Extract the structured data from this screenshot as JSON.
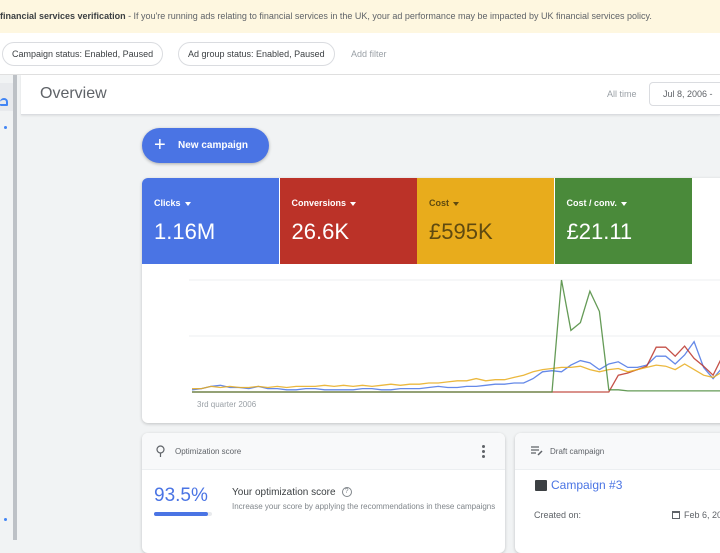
{
  "banner": {
    "title": "financial services verification",
    "text": " - If you're running ads relating to financial services in the UK, your ad performance may be impacted by UK financial services policy."
  },
  "filters": {
    "chips": [
      "Campaign status: Enabled, Paused",
      "Ad group status: Enabled, Paused"
    ],
    "add_filter": "Add filter"
  },
  "header": {
    "title": "Overview",
    "range_label": "All time",
    "date_range": "Jul 8, 2006 -"
  },
  "new_campaign": {
    "label": "New campaign",
    "icon": "plus-icon"
  },
  "metrics": [
    {
      "label": "Clicks",
      "value": "1.16M",
      "color": "#4a74e4",
      "text_color": "#ffffff"
    },
    {
      "label": "Conversions",
      "value": "26.6K",
      "color": "#bb3228",
      "text_color": "#ffffff"
    },
    {
      "label": "Cost",
      "value": "£595K",
      "color": "#e8ac1c",
      "text_color": "#5f4a10"
    },
    {
      "label": "Cost / conv.",
      "value": "£21.11",
      "color": "#4a8a3a",
      "text_color": "#ffffff"
    }
  ],
  "chart_data": {
    "type": "line",
    "x_label": "3rd quarter 2006",
    "grid": true,
    "y_range": [
      0,
      1
    ],
    "series": [
      {
        "name": "Clicks",
        "color": "#4a74e4",
        "values": [
          0.02,
          0.03,
          0.05,
          0.06,
          0.04,
          0.04,
          0.03,
          0.05,
          0.03,
          0.03,
          0.02,
          0.02,
          0.03,
          0.03,
          0.02,
          0.02,
          0.02,
          0.02,
          0.03,
          0.03,
          0.02,
          0.02,
          0.03,
          0.03,
          0.03,
          0.04,
          0.05,
          0.04,
          0.04,
          0.05,
          0.05,
          0.06,
          0.07,
          0.07,
          0.08,
          0.08,
          0.12,
          0.18,
          0.19,
          0.18,
          0.24,
          0.28,
          0.26,
          0.2,
          0.25,
          0.27,
          0.22,
          0.22,
          0.24,
          0.32,
          0.32,
          0.25,
          0.33,
          0.45,
          0.22,
          0.12,
          0.22,
          0.4
        ]
      },
      {
        "name": "Conversions",
        "color": "#bb3228",
        "values": [
          0,
          0,
          0,
          0,
          0,
          0,
          0,
          0,
          0,
          0,
          0,
          0,
          0,
          0,
          0,
          0,
          0,
          0,
          0,
          0,
          0,
          0,
          0,
          0,
          0,
          0,
          0,
          0,
          0,
          0,
          0,
          0,
          0,
          0,
          0,
          0,
          0,
          0,
          0,
          0,
          0,
          0,
          0,
          0,
          0,
          0.15,
          0.17,
          0.2,
          0.23,
          0.4,
          0.4,
          0.32,
          0.41,
          0.3,
          0.23,
          0.15,
          0.32,
          0.45
        ]
      },
      {
        "name": "Cost",
        "color": "#e8ac1c",
        "values": [
          0.03,
          0.03,
          0.05,
          0.04,
          0.05,
          0.04,
          0.04,
          0.05,
          0.04,
          0.05,
          0.04,
          0.05,
          0.05,
          0.05,
          0.06,
          0.05,
          0.06,
          0.05,
          0.06,
          0.05,
          0.06,
          0.07,
          0.06,
          0.07,
          0.07,
          0.08,
          0.08,
          0.09,
          0.1,
          0.1,
          0.12,
          0.1,
          0.11,
          0.11,
          0.13,
          0.15,
          0.18,
          0.2,
          0.21,
          0.22,
          0.22,
          0.23,
          0.2,
          0.18,
          0.2,
          0.21,
          0.18,
          0.2,
          0.22,
          0.24,
          0.23,
          0.2,
          0.25,
          0.2,
          0.15,
          0.13,
          0.18,
          0.22
        ]
      },
      {
        "name": "Cost / conv.",
        "color": "#4a8a3a",
        "values": [
          0,
          0,
          0,
          0,
          0,
          0,
          0,
          0,
          0,
          0,
          0,
          0,
          0,
          0,
          0,
          0,
          0,
          0,
          0,
          0,
          0,
          0,
          0,
          0,
          0,
          0,
          0,
          0,
          0,
          0,
          0,
          0,
          0,
          0,
          0,
          0,
          0,
          0,
          0,
          1.0,
          0.55,
          0.62,
          0.9,
          0.72,
          0.02,
          0.02,
          0.01,
          0.01,
          0.01,
          0.01,
          0.01,
          0.01,
          0.01,
          0.01,
          0.01,
          0.01,
          0.01,
          0.01
        ]
      }
    ]
  },
  "optimization": {
    "header": "Optimization score",
    "score": "93.5%",
    "score_fraction": 0.935,
    "title": "Your optimization score",
    "description": "Increase your score by applying the recommendations in these campaigns"
  },
  "draft": {
    "header": "Draft campaign",
    "campaign_name": "Campaign #3",
    "created_label": "Created on:",
    "created_value": "Feb 6, 20"
  }
}
